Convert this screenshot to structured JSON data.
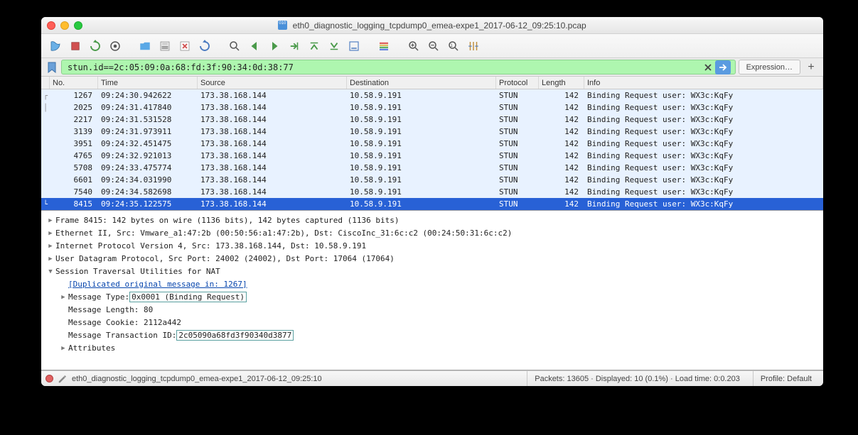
{
  "window": {
    "title": "eth0_diagnostic_logging_tcpdump0_emea-expe1_2017-06-12_09:25:10.pcap"
  },
  "filter": {
    "value": "stun.id==2c:05:09:0a:68:fd:3f:90:34:0d:38:77",
    "expression_label": "Expression…"
  },
  "columns": {
    "no": "No.",
    "time": "Time",
    "source": "Source",
    "destination": "Destination",
    "protocol": "Protocol",
    "length": "Length",
    "info": "Info"
  },
  "packets": [
    {
      "no": "1267",
      "time": "09:24:30.942622",
      "src": "173.38.168.144",
      "dst": "10.58.9.191",
      "proto": "STUN",
      "len": "142",
      "info": "Binding Request user: WX3c:KqFy",
      "tree": "┌"
    },
    {
      "no": "2025",
      "time": "09:24:31.417840",
      "src": "173.38.168.144",
      "dst": "10.58.9.191",
      "proto": "STUN",
      "len": "142",
      "info": "Binding Request user: WX3c:KqFy",
      "tree": "│"
    },
    {
      "no": "2217",
      "time": "09:24:31.531528",
      "src": "173.38.168.144",
      "dst": "10.58.9.191",
      "proto": "STUN",
      "len": "142",
      "info": "Binding Request user: WX3c:KqFy",
      "tree": ""
    },
    {
      "no": "3139",
      "time": "09:24:31.973911",
      "src": "173.38.168.144",
      "dst": "10.58.9.191",
      "proto": "STUN",
      "len": "142",
      "info": "Binding Request user: WX3c:KqFy",
      "tree": ""
    },
    {
      "no": "3951",
      "time": "09:24:32.451475",
      "src": "173.38.168.144",
      "dst": "10.58.9.191",
      "proto": "STUN",
      "len": "142",
      "info": "Binding Request user: WX3c:KqFy",
      "tree": ""
    },
    {
      "no": "4765",
      "time": "09:24:32.921013",
      "src": "173.38.168.144",
      "dst": "10.58.9.191",
      "proto": "STUN",
      "len": "142",
      "info": "Binding Request user: WX3c:KqFy",
      "tree": ""
    },
    {
      "no": "5708",
      "time": "09:24:33.475774",
      "src": "173.38.168.144",
      "dst": "10.58.9.191",
      "proto": "STUN",
      "len": "142",
      "info": "Binding Request user: WX3c:KqFy",
      "tree": ""
    },
    {
      "no": "6601",
      "time": "09:24:34.031990",
      "src": "173.38.168.144",
      "dst": "10.58.9.191",
      "proto": "STUN",
      "len": "142",
      "info": "Binding Request user: WX3c:KqFy",
      "tree": ""
    },
    {
      "no": "7540",
      "time": "09:24:34.582698",
      "src": "173.38.168.144",
      "dst": "10.58.9.191",
      "proto": "STUN",
      "len": "142",
      "info": "Binding Request user: WX3c:KqFy",
      "tree": ""
    },
    {
      "no": "8415",
      "time": "09:24:35.122575",
      "src": "173.38.168.144",
      "dst": "10.58.9.191",
      "proto": "STUN",
      "len": "142",
      "info": "Binding Request user: WX3c:KqFy",
      "tree": "└",
      "selected": true
    }
  ],
  "details": {
    "frame": "Frame 8415: 142 bytes on wire (1136 bits), 142 bytes captured (1136 bits)",
    "eth": "Ethernet II, Src: Vmware_a1:47:2b (00:50:56:a1:47:2b), Dst: CiscoInc_31:6c:c2 (00:24:50:31:6c:c2)",
    "ip": "Internet Protocol Version 4, Src: 173.38.168.144, Dst: 10.58.9.191",
    "udp": "User Datagram Protocol, Src Port: 24002 (24002), Dst Port: 17064 (17064)",
    "stun": "Session Traversal Utilities for NAT",
    "dup": "[Duplicated original message in: 1267]",
    "msgtype_label": "Message Type: ",
    "msgtype_value": "0x0001 (Binding Request)",
    "msglen": "Message Length: 80",
    "cookie": "Message Cookie: 2112a442",
    "tid_label": "Message Transaction ID: ",
    "tid_value": "2c05090a68fd3f90340d3877",
    "attrs": "Attributes"
  },
  "status": {
    "file": "eth0_diagnostic_logging_tcpdump0_emea-expe1_2017-06-12_09:25:10",
    "packets": "Packets: 13605 · Displayed: 10 (0.1%) · Load time: 0:0.203",
    "profile": "Profile: Default"
  }
}
